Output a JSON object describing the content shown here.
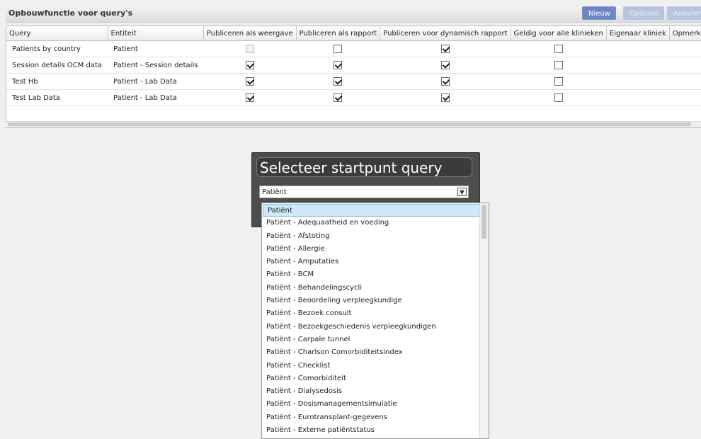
{
  "header": {
    "title": "Opbouwfunctie voor query's",
    "new_label": "Nieuw",
    "save_label": "Opslaan",
    "cancel_label": "Annuleren"
  },
  "table": {
    "columns": [
      "Query",
      "Entiteit",
      "Publiceren als weergave",
      "Publiceren als rapport",
      "Publiceren voor dynamisch rapport",
      "Geldig voor alle klinieken",
      "Eigenaar kliniek",
      "Opmerking"
    ],
    "rows": [
      {
        "query": "Patients by country",
        "entity": "Patient",
        "view": false,
        "view_disabled": true,
        "report": false,
        "dynamic": true,
        "all_clinics": false
      },
      {
        "query": "Session details OCM data",
        "entity": "Patient - Session details",
        "view": true,
        "view_disabled": false,
        "report": true,
        "dynamic": true,
        "all_clinics": false
      },
      {
        "query": "Test Hb",
        "entity": "Patient - Lab Data",
        "view": true,
        "view_disabled": false,
        "report": true,
        "dynamic": true,
        "all_clinics": false
      },
      {
        "query": "Test Lab Data",
        "entity": "Patient - Lab Data",
        "view": true,
        "view_disabled": false,
        "report": true,
        "dynamic": true,
        "all_clinics": false
      }
    ]
  },
  "dialog": {
    "title": "Selecteer startpunt query",
    "selected": "Patiënt"
  },
  "options": [
    "Patiënt",
    "Patiënt - Adequaatheid en voeding",
    "Patiënt - Afstoting",
    "Patiënt - Allergie",
    "Patiënt - Amputaties",
    "Patiënt - BCM",
    "Patiënt - Behandelingscycli",
    "Patiënt - Beoordeling verpleegkundige",
    "Patiënt - Bezoek consult",
    "Patiënt - Bezoekgeschiedenis verpleegkundigen",
    "Patiënt - Carpale tunnel",
    "Patiënt - Charlson Comorbiditeitsindex",
    "Patiënt - Checklist",
    "Patiënt - Comorbiditeit",
    "Patiënt - Dialysedosis",
    "Patiënt - Dosismanagementsimulatie",
    "Patiënt - Eurotransplant-gegevens",
    "Patiënt - Externe patiëntstatus"
  ]
}
